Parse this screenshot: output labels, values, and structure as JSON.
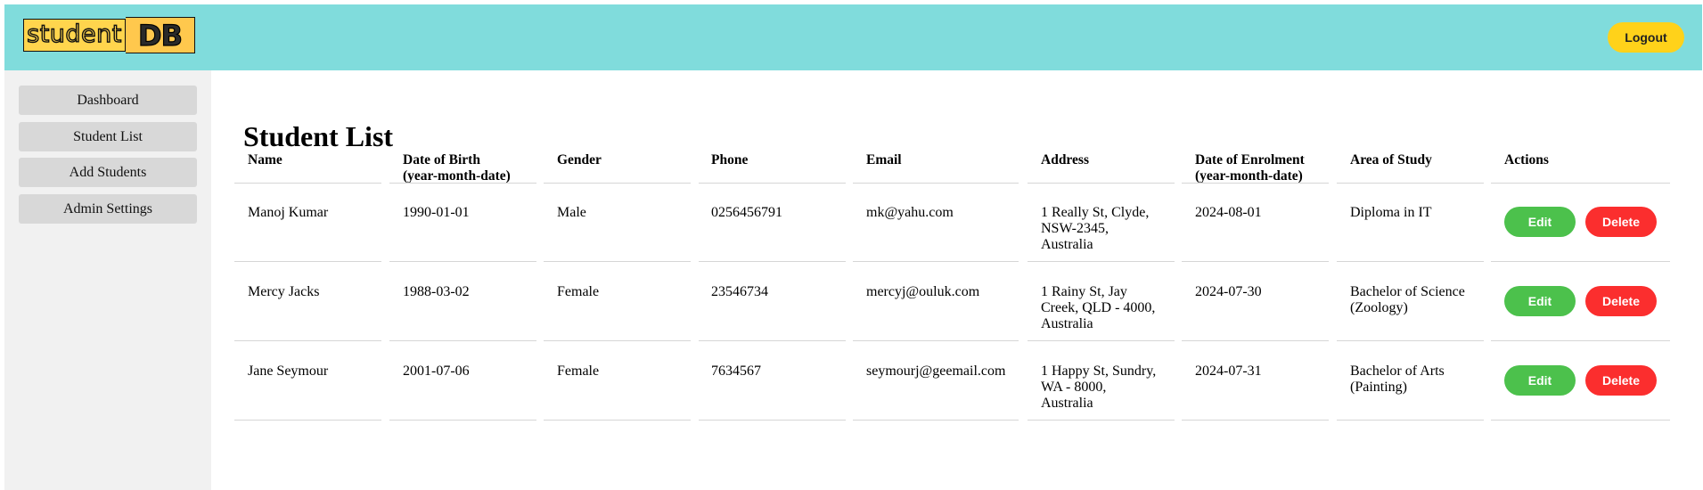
{
  "header": {
    "logo_part1": "student",
    "logo_part2": "DB",
    "logout_label": "Logout",
    "colors": {
      "header_bg": "#80dcdc",
      "logout_bg": "#ffd21a"
    }
  },
  "sidebar": {
    "items": [
      {
        "label": "Dashboard"
      },
      {
        "label": "Student List"
      },
      {
        "label": "Add Students"
      },
      {
        "label": "Admin Settings"
      }
    ]
  },
  "main": {
    "title": "Student List",
    "columns": [
      "Name",
      "Date of Birth\n(year-month-date)",
      "Gender",
      "Phone",
      "Email",
      "Address",
      "Date of Enrolment\n(year-month-date)",
      "Area of Study",
      "Actions"
    ],
    "rows": [
      {
        "name": "Manoj Kumar",
        "dob": "1990-01-01",
        "gender": "Male",
        "phone": "0256456791",
        "email": "mk@yahu.com",
        "address": "1 Really St, Clyde,\nNSW-2345,\nAustralia",
        "enrolment": "2024-08-01",
        "area": "Diploma in IT"
      },
      {
        "name": "Mercy Jacks",
        "dob": "1988-03-02",
        "gender": "Female",
        "phone": "23546734",
        "email": "mercyj@ouluk.com",
        "address": "1 Rainy St, Jay\nCreek, QLD - 4000,\nAustralia",
        "enrolment": "2024-07-30",
        "area": "Bachelor of Science\n(Zoology)"
      },
      {
        "name": "Jane Seymour",
        "dob": "2001-07-06",
        "gender": "Female",
        "phone": "7634567",
        "email": "seymourj@geemail.com",
        "address": "1 Happy St, Sundry,\nWA - 8000,\nAustralia",
        "enrolment": "2024-07-31",
        "area": "Bachelor of Arts\n(Painting)"
      }
    ],
    "actions": {
      "edit_label": "Edit",
      "delete_label": "Delete"
    },
    "colors": {
      "edit": "#4cc14c",
      "delete": "#fb2e2e"
    }
  }
}
